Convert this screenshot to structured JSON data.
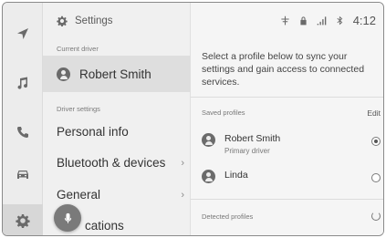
{
  "rail": {
    "items": [
      {
        "icon": "navigation-arrow-icon"
      },
      {
        "icon": "music-note-icon"
      },
      {
        "icon": "phone-icon"
      },
      {
        "icon": "car-icon"
      },
      {
        "icon": "gear-icon"
      }
    ]
  },
  "settings_list": {
    "title": "Settings",
    "current_driver_label": "Current driver",
    "current_driver_name": "Robert Smith",
    "driver_settings_label": "Driver settings",
    "items": [
      {
        "label": "Personal info",
        "has_chevron": false
      },
      {
        "label": "Bluetooth & devices",
        "has_chevron": true,
        "chevron": "›"
      },
      {
        "label": "General",
        "has_chevron": true,
        "chevron": "›"
      },
      {
        "label": "cations",
        "has_chevron": false
      }
    ]
  },
  "status_bar": {
    "time": "4:12",
    "icons": [
      "connection-icon",
      "lock-icon",
      "signal-icon",
      "bluetooth-icon"
    ]
  },
  "content": {
    "intro": "Select a profile below to sync your settings and gain access to connected services.",
    "saved_profiles_label": "Saved profiles",
    "edit_label": "Edit",
    "profiles": [
      {
        "name": "Robert Smith",
        "subtitle": "Primary driver",
        "selected": true
      },
      {
        "name": "Linda",
        "subtitle": "",
        "selected": false
      }
    ],
    "detected_profiles_label": "Detected profiles"
  },
  "colors": {
    "rail_bg": "#ececec",
    "list_bg": "#f0f0f0",
    "selected_row": "#dedede",
    "content_bg": "#f5f5f5",
    "mic_button": "#7a7a7a"
  }
}
